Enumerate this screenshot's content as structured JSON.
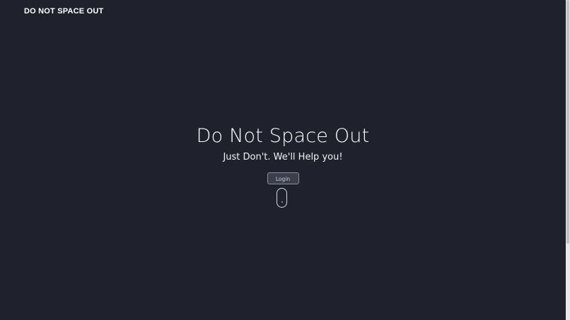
{
  "header": {
    "brand": "DO NOT SPACE OUT"
  },
  "hero": {
    "title": "Do Not Space Out",
    "subtitle": "Just Don't. We'll Help you!",
    "login_label": "Login"
  },
  "icons": {
    "scroll": "mouse-scroll-icon"
  },
  "colors": {
    "background": "#1f222c",
    "text": "#ffffff",
    "button_bg": "#3a3f4b",
    "button_border": "#8a8f9c"
  }
}
